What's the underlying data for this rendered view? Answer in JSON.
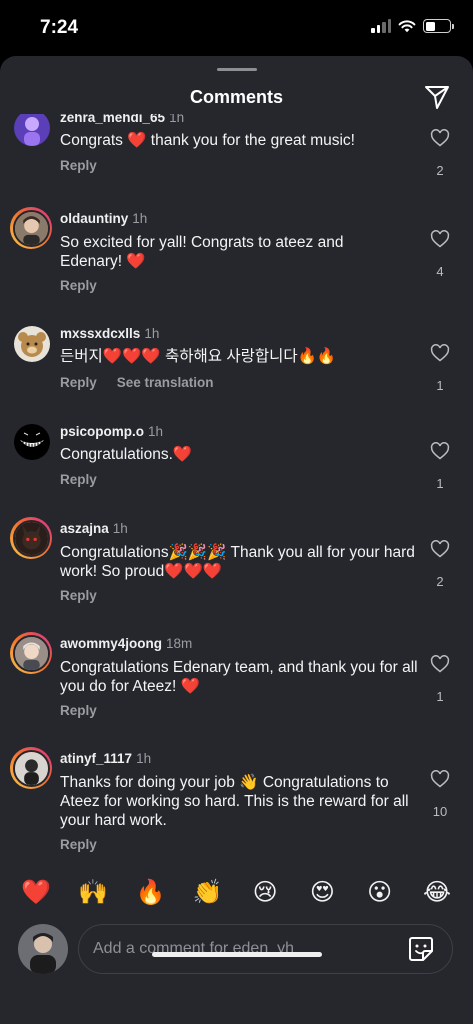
{
  "status_bar": {
    "time": "7:24"
  },
  "sheet": {
    "title": "Comments"
  },
  "comments": [
    {
      "username": "zehra_mehdi_65",
      "time": "1h",
      "text": "Congrats ❤️ thank you for the great music!",
      "reply": "Reply",
      "likes": "2"
    },
    {
      "username": "oldauntiny",
      "time": "1h",
      "text": "So excited for yall! Congrats to ateez and Edenary! ❤️",
      "reply": "Reply",
      "likes": "4"
    },
    {
      "username": "mxssxdcxlls",
      "time": "1h",
      "text": "든버지❤️❤️❤️ 축하해요 사랑합니다🔥🔥",
      "reply": "Reply",
      "translate": "See translation",
      "likes": "1"
    },
    {
      "username": "psicopomp.o",
      "time": "1h",
      "text": "Congratulations.❤️",
      "reply": "Reply",
      "likes": "1"
    },
    {
      "username": "aszajna",
      "time": "1h",
      "text": "Congratulations🎉🎉🎉 Thank you all for your hard work!  So proud❤️❤️❤️",
      "reply": "Reply",
      "likes": "2"
    },
    {
      "username": "awommy4joong",
      "time": "18m",
      "text": "Congratulations Edenary team, and thank you for all you do for Ateez! ❤️",
      "reply": "Reply",
      "likes": "1"
    },
    {
      "username": "atinyf_1117",
      "time": "1h",
      "text": "Thanks for doing your job 👋 Congratulations to Ateez for working so hard. This is the reward for all your hard work.",
      "reply": "Reply",
      "likes": "10"
    }
  ],
  "emoji_bar": [
    "❤️",
    "🙌",
    "🔥",
    "👏",
    "😢",
    "😍",
    "😮",
    "😂"
  ],
  "composer": {
    "placeholder": "Add a comment for eden_yh"
  }
}
